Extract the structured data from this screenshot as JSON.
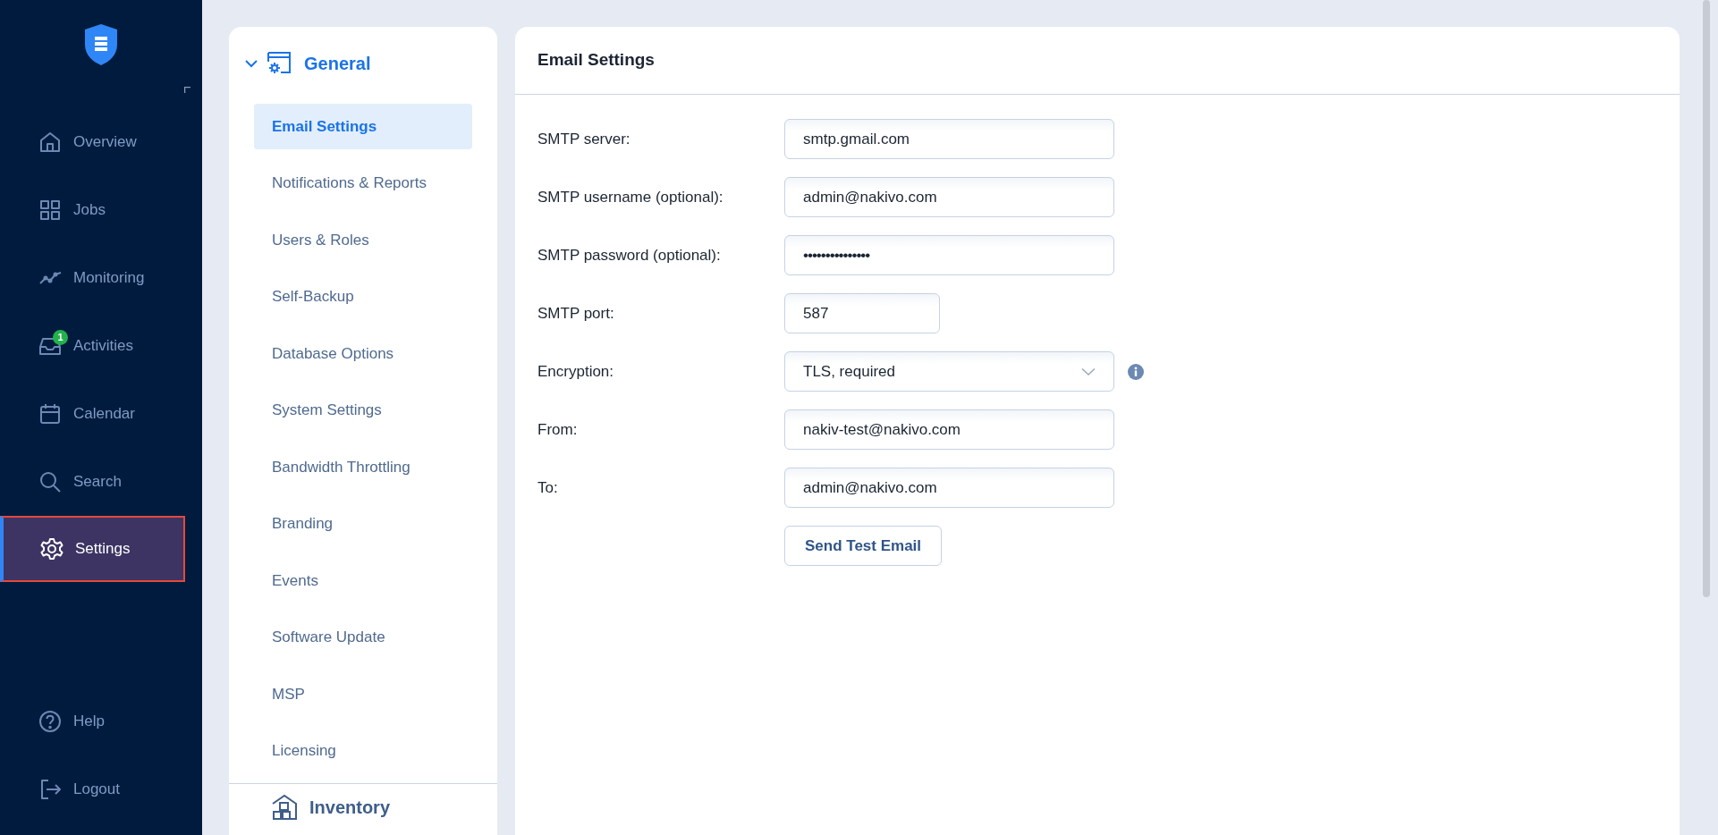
{
  "nav": {
    "items": [
      {
        "label": "Overview",
        "kind": "home",
        "selected": false
      },
      {
        "label": "Jobs",
        "kind": "grid",
        "selected": false
      },
      {
        "label": "Monitoring",
        "kind": "chart",
        "selected": false
      },
      {
        "label": "Activities",
        "kind": "inbox",
        "selected": false,
        "badge": "1"
      },
      {
        "label": "Calendar",
        "kind": "calendar",
        "selected": false
      },
      {
        "label": "Search",
        "kind": "search",
        "selected": false
      },
      {
        "label": "Settings",
        "kind": "gear",
        "selected": true
      }
    ],
    "bottom": [
      {
        "label": "Help",
        "kind": "help"
      },
      {
        "label": "Logout",
        "kind": "logout"
      }
    ]
  },
  "settings_menu": {
    "sections": [
      {
        "title": "General",
        "kind": "general",
        "expanded": true,
        "items": [
          {
            "label": "Email Settings",
            "selected": true
          },
          {
            "label": "Notifications & Reports",
            "selected": false
          },
          {
            "label": "Users & Roles",
            "selected": false
          },
          {
            "label": "Self-Backup",
            "selected": false
          },
          {
            "label": "Database Options",
            "selected": false
          },
          {
            "label": "System Settings",
            "selected": false
          },
          {
            "label": "Bandwidth Throttling",
            "selected": false
          },
          {
            "label": "Branding",
            "selected": false
          },
          {
            "label": "Events",
            "selected": false
          },
          {
            "label": "Software Update",
            "selected": false
          },
          {
            "label": "MSP",
            "selected": false
          },
          {
            "label": "Licensing",
            "selected": false
          }
        ]
      },
      {
        "title": "Inventory",
        "kind": "inventory",
        "expanded": false
      }
    ]
  },
  "email_settings": {
    "title": "Email Settings",
    "fields": [
      {
        "label": "SMTP server:",
        "kind": "text",
        "value": "smtp.gmail.com"
      },
      {
        "label": "SMTP username (optional):",
        "kind": "text",
        "value": "admin@nakivo.com"
      },
      {
        "label": "SMTP password (optional):",
        "kind": "password",
        "value": "•••••••••••••••"
      },
      {
        "label": "SMTP port:",
        "kind": "short",
        "value": "587"
      },
      {
        "label": "Encryption:",
        "kind": "select",
        "value": "TLS, required",
        "info": true
      },
      {
        "label": "From:",
        "kind": "text",
        "value": "nakiv-test@nakivo.com"
      },
      {
        "label": "To:",
        "kind": "text",
        "value": "admin@nakivo.com"
      }
    ],
    "button": "Send Test Email"
  }
}
